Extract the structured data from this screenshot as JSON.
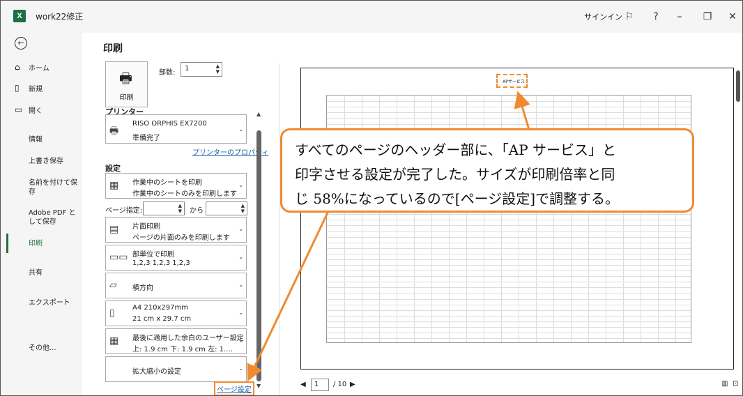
{
  "window": {
    "app_icon": "X",
    "title": "work22修正",
    "signin": "サインイン"
  },
  "sidebar": {
    "items": [
      {
        "icon": "home-icon",
        "label": "ホーム"
      },
      {
        "icon": "new-icon",
        "label": "新規"
      },
      {
        "icon": "open-icon",
        "label": "開く"
      }
    ],
    "items2": [
      "情報",
      "上書き保存",
      "名前を付けて保存",
      "Adobe PDF として保存",
      "印刷",
      "共有",
      "エクスポート",
      "その他..."
    ]
  },
  "print": {
    "title": "印刷",
    "print_button": "印刷",
    "copies_label": "部数:",
    "copies_value": "1",
    "printer_section": "プリンター",
    "printer_name": "RISO ORPHIS EX7200",
    "printer_status": "準備完了",
    "printer_props_link": "プリンターのプロパティ",
    "settings_section": "設定",
    "sheet_l1": "作業中のシートを印刷",
    "sheet_l2": "作業中のシートのみを印刷します",
    "pages_label": "ページ指定:",
    "pages_to": "から",
    "sided_l1": "片面印刷",
    "sided_l2": "ページの片面のみを印刷します",
    "collate_l1": "部単位で印刷",
    "collate_l2": "1,2,3   1,2,3   1,2,3",
    "orientation": "横方向",
    "paper_l1": "A4 210x297mm",
    "paper_l2": "21 cm x 29.7 cm",
    "margin_l1": "最後に適用した余白のユーザー設定",
    "margin_l2": "上: 1.9 cm 下: 1.9 cm 左: 1.…",
    "scaling": "拡大縮小の設定",
    "page_setup_link": "ページ設定"
  },
  "preview": {
    "header": "APサービス",
    "page_current": "1",
    "page_total": "/ 10"
  },
  "callout": {
    "line1": "すべてのページのヘッダー部に、「AP サービス」と",
    "line2": "印字させる設定が完了した。サイズが印刷倍率と同",
    "line3": "じ 58%になっているので[ページ設定]で調整する。"
  },
  "colors": {
    "accent": "#ef8a2f",
    "excel_green": "#1d6f42"
  }
}
